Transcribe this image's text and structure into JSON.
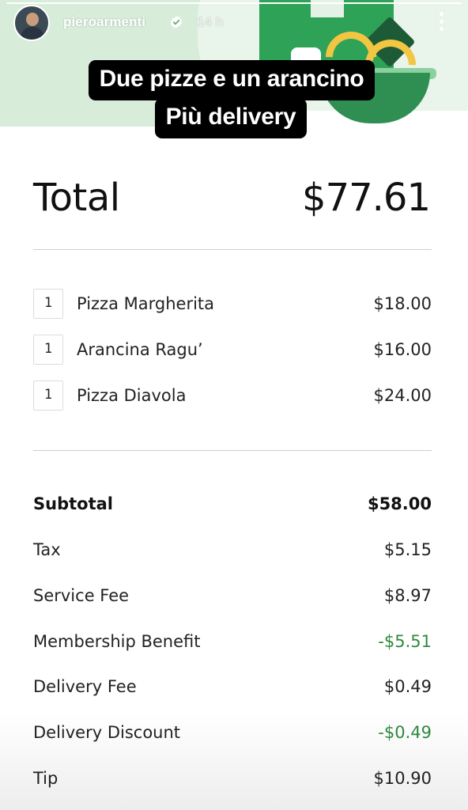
{
  "story": {
    "username": "pieroarmenti",
    "time": "14 h",
    "progress": 1.0,
    "caption": {
      "line1": "Due pizze e un arancino",
      "line2": "Più delivery"
    }
  },
  "receipt": {
    "total_label": "Total",
    "total_value": "$77.61",
    "items": [
      {
        "qty": "1",
        "name": "Pizza Margherita",
        "price": "$18.00"
      },
      {
        "qty": "1",
        "name": "Arancina Ragu’",
        "price": "$16.00"
      },
      {
        "qty": "1",
        "name": "Pizza Diavola",
        "price": "$24.00"
      }
    ],
    "summary": [
      {
        "label": "Subtotal",
        "value": "$58.00"
      },
      {
        "label": "Tax",
        "value": "$5.15"
      },
      {
        "label": "Service Fee",
        "value": "$8.97"
      },
      {
        "label": "Membership Benefit",
        "value": "-$5.51"
      },
      {
        "label": "Delivery Fee",
        "value": "$0.49"
      },
      {
        "label": "Delivery Discount",
        "value": "-$0.49"
      },
      {
        "label": "Tip",
        "value": "$10.90"
      }
    ]
  },
  "colors": {
    "discount_green": "#2e8a3e",
    "brand_green": "#2ea256",
    "caption_bg": "#000000"
  },
  "icons": {
    "verified": "verified-badge-icon",
    "more": "more-vertical-icon"
  }
}
